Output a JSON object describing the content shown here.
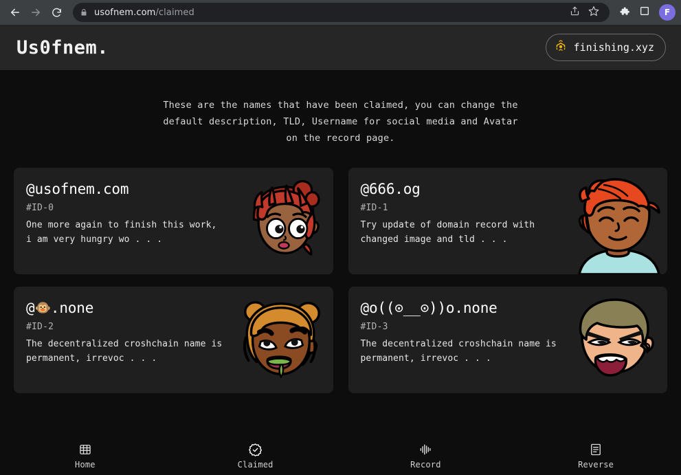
{
  "browser": {
    "back_icon": "back-arrow-icon",
    "forward_icon": "forward-arrow-icon",
    "reload_icon": "reload-icon",
    "lock_icon": "lock-icon",
    "url_domain": "usofnem.com",
    "url_path": "/claimed",
    "share_icon": "share-icon",
    "bookmark_icon": "star-icon",
    "extensions_icon": "puzzle-piece-icon",
    "sidepanel_icon": "side-panel-icon",
    "profile_initial": "F"
  },
  "header": {
    "brand": "Us0fnem.",
    "chain_badge": {
      "icon": "bnb-chain-icon",
      "label": "finishing.xyz",
      "color": "#f0b90b"
    }
  },
  "intro": {
    "line1": "These are the names that have been claimed, you can change the",
    "line2": "default description, TLD, Username for social media and Avatar",
    "line3": "on the record page."
  },
  "cards": [
    {
      "title": "@usofnem.com",
      "title_prefix": "@usofnem.com",
      "title_emoji": "",
      "title_suffix": "",
      "id": "#ID-0",
      "description": "One more again to finish this work, i am very hungry wo . . .",
      "avatar": "avatar-red-haired-girl"
    },
    {
      "title": "@666.og",
      "title_prefix": "@666.og",
      "title_emoji": "",
      "title_suffix": "",
      "id": "#ID-1",
      "description": "Try update of domain record with changed image and tld . . .",
      "avatar": "avatar-orange-haired-boy"
    },
    {
      "title": "@🐵.none",
      "title_prefix": "@",
      "title_emoji": "🐵",
      "title_suffix": ".none",
      "id": "#ID-2",
      "description": "The decentralized croshchain name is permanent, irrevoc . . .",
      "avatar": "avatar-blonde-bun-girl"
    },
    {
      "title": "@o((⊙__⊙))o.none",
      "title_prefix": "@o((⊙__⊙))o.none",
      "title_emoji": "",
      "title_suffix": "",
      "id": "#ID-3",
      "description": "The decentralized croshchain name is permanent, irrevoc . . .",
      "avatar": "avatar-angry-blond-man"
    }
  ],
  "bottom_nav": [
    {
      "label": "Home",
      "icon": "grid-icon"
    },
    {
      "label": "Claimed",
      "icon": "verified-badge-icon"
    },
    {
      "label": "Record",
      "icon": "waveform-icon"
    },
    {
      "label": "Reverse",
      "icon": "document-lines-icon"
    }
  ],
  "colors": {
    "page_bg": "#0d0d0d",
    "card_bg": "#1f1f1f",
    "header_bg": "#262626",
    "accent": "#f0b90b",
    "text": "#ffffff"
  }
}
